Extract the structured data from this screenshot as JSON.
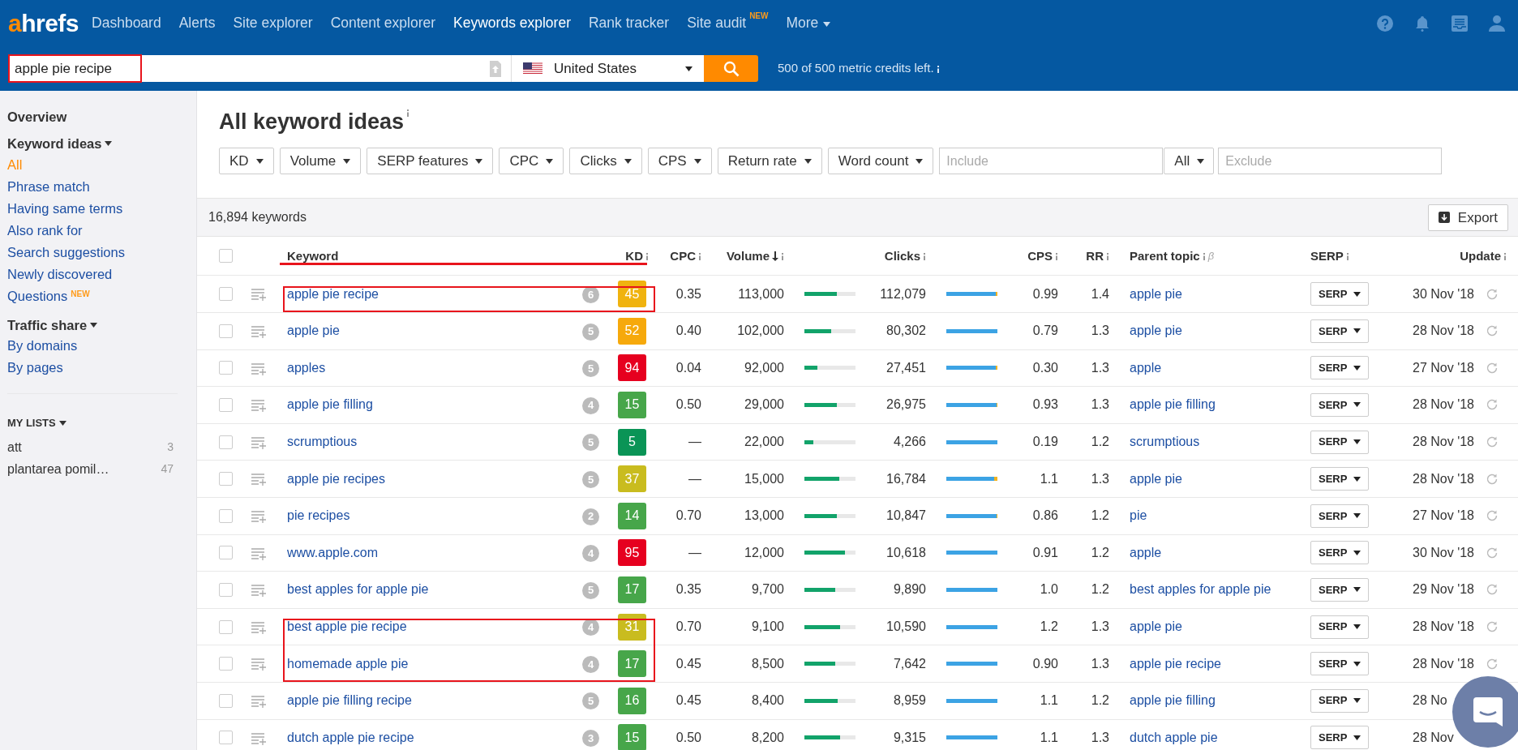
{
  "logo": "ahrefs",
  "nav": [
    {
      "label": "Dashboard",
      "selected": false
    },
    {
      "label": "Alerts",
      "selected": false
    },
    {
      "label": "Site explorer",
      "selected": false
    },
    {
      "label": "Content explorer",
      "selected": false
    },
    {
      "label": "Keywords explorer",
      "selected": true
    },
    {
      "label": "Rank tracker",
      "selected": false
    },
    {
      "label": "Site audit",
      "selected": false,
      "badge": "NEW"
    },
    {
      "label": "More",
      "selected": false,
      "dropdown": true
    }
  ],
  "search": {
    "value": "apple pie recipe",
    "highlighted": true,
    "country": "United States",
    "credits": "500 of 500 metric credits left."
  },
  "sidebar": {
    "overview": "Overview",
    "sections": [
      {
        "title": "Keyword ideas",
        "items": [
          {
            "label": "All",
            "selected": true
          },
          {
            "label": "Phrase match",
            "selected": false
          },
          {
            "label": "Having same terms",
            "selected": false
          },
          {
            "label": "Also rank for",
            "selected": false
          },
          {
            "label": "Search suggestions",
            "selected": false
          },
          {
            "label": "Newly discovered",
            "selected": false
          },
          {
            "label": "Questions",
            "selected": false,
            "badge": "NEW"
          }
        ]
      },
      {
        "title": "Traffic share",
        "items": [
          {
            "label": "By domains",
            "selected": false
          },
          {
            "label": "By pages",
            "selected": false
          }
        ]
      }
    ],
    "lists_title": "MY LISTS",
    "lists": [
      {
        "name": "att",
        "count": "3"
      },
      {
        "name": "plantarea pomil…",
        "count": "47"
      }
    ]
  },
  "page_title": "All keyword ideas",
  "filters": [
    "KD",
    "Volume",
    "SERP features",
    "CPC",
    "Clicks",
    "CPS",
    "Return rate",
    "Word count"
  ],
  "include": {
    "placeholder": "Include",
    "mode": "All"
  },
  "exclude": {
    "placeholder": "Exclude"
  },
  "count": "16,894 keywords",
  "export": "Export",
  "table": {
    "header_checked": false,
    "keyword_header_underlined": true,
    "columns": [
      {
        "label": "Keyword",
        "info": false
      },
      {
        "label": "KD",
        "info": true
      },
      {
        "label": "CPC",
        "info": true
      },
      {
        "label": "Volume",
        "info": true,
        "sorted": true
      },
      {
        "label": "Clicks",
        "info": true
      },
      {
        "label": "CPS",
        "info": true
      },
      {
        "label": "RR",
        "info": true
      },
      {
        "label": "Parent topic",
        "info": true,
        "badge": "β"
      },
      {
        "label": "SERP",
        "info": true
      },
      {
        "label": "Update",
        "info": true
      }
    ],
    "rows": [
      {
        "checked": false,
        "keyword": "apple pie recipe",
        "count": "6",
        "kd": {
          "value": "45",
          "color": "#f0b30f"
        },
        "cpc": "0.35",
        "volume": "113,000",
        "volume_bar": {
          "level": 0.64
        },
        "clicks": "112,079",
        "clicks_bar": {
          "level": 0.97
        },
        "cps": "0.99",
        "rr": "1.4",
        "parent_topic": "apple pie",
        "serp": "SERP",
        "update": "30 Nov '18",
        "refresh": true,
        "highlighted": true
      },
      {
        "checked": false,
        "keyword": "apple pie",
        "count": "5",
        "kd": {
          "value": "52",
          "color": "#f6a90c"
        },
        "cpc": "0.40",
        "volume": "102,000",
        "volume_bar": {
          "level": 0.53
        },
        "clicks": "80,302",
        "clicks_bar": {
          "level": 1
        },
        "cps": "0.79",
        "rr": "1.3",
        "parent_topic": "apple pie",
        "serp": "SERP",
        "update": "28 Nov '18",
        "refresh": true,
        "highlighted": false
      },
      {
        "checked": false,
        "keyword": "apples",
        "count": "5",
        "kd": {
          "value": "94",
          "color": "#e6001f"
        },
        "cpc": "0.04",
        "volume": "92,000",
        "volume_bar": {
          "level": 0.25
        },
        "clicks": "27,451",
        "clicks_bar": {
          "level": 0.97
        },
        "cps": "0.30",
        "rr": "1.3",
        "parent_topic": "apple",
        "serp": "SERP",
        "update": "27 Nov '18",
        "refresh": true,
        "highlighted": false
      },
      {
        "checked": false,
        "keyword": "apple pie filling",
        "count": "4",
        "kd": {
          "value": "15",
          "color": "#47a64a"
        },
        "cpc": "0.50",
        "volume": "29,000",
        "volume_bar": {
          "level": 0.64
        },
        "clicks": "26,975",
        "clicks_bar": {
          "level": 0.98
        },
        "cps": "0.93",
        "rr": "1.3",
        "parent_topic": "apple pie filling",
        "serp": "SERP",
        "update": "28 Nov '18",
        "refresh": true,
        "highlighted": false
      },
      {
        "checked": false,
        "keyword": "scrumptious",
        "count": "5",
        "kd": {
          "value": "5",
          "color": "#0a9456"
        },
        "cpc": "—",
        "volume": "22,000",
        "volume_bar": {
          "level": 0.17
        },
        "clicks": "4,266",
        "clicks_bar": {
          "level": 1
        },
        "cps": "0.19",
        "rr": "1.2",
        "parent_topic": "scrumptious",
        "serp": "SERP",
        "update": "28 Nov '18",
        "refresh": true,
        "highlighted": false
      },
      {
        "checked": false,
        "keyword": "apple pie recipes",
        "count": "5",
        "kd": {
          "value": "37",
          "color": "#c9bc1f"
        },
        "cpc": "—",
        "volume": "15,000",
        "volume_bar": {
          "level": 0.68
        },
        "clicks": "16,784",
        "clicks_bar": {
          "level": 0.93
        },
        "cps": "1.1",
        "rr": "1.3",
        "parent_topic": "apple pie",
        "serp": "SERP",
        "update": "28 Nov '18",
        "refresh": true,
        "highlighted": false
      },
      {
        "checked": false,
        "keyword": "pie recipes",
        "count": "2",
        "kd": {
          "value": "14",
          "color": "#47a64a"
        },
        "cpc": "0.70",
        "volume": "13,000",
        "volume_bar": {
          "level": 0.64
        },
        "clicks": "10,847",
        "clicks_bar": {
          "level": 0.98
        },
        "cps": "0.86",
        "rr": "1.2",
        "parent_topic": "pie",
        "serp": "SERP",
        "update": "27 Nov '18",
        "refresh": true,
        "highlighted": false
      },
      {
        "checked": false,
        "keyword": "www.apple.com",
        "count": "4",
        "kd": {
          "value": "95",
          "color": "#e6001f"
        },
        "cpc": "—",
        "volume": "12,000",
        "volume_bar": {
          "level": 0.8
        },
        "clicks": "10,618",
        "clicks_bar": {
          "level": 1
        },
        "cps": "0.91",
        "rr": "1.2",
        "parent_topic": "apple",
        "serp": "SERP",
        "update": "30 Nov '18",
        "refresh": true,
        "highlighted": false
      },
      {
        "checked": false,
        "keyword": "best apples for apple pie",
        "count": "5",
        "kd": {
          "value": "17",
          "color": "#47a64a"
        },
        "cpc": "0.35",
        "volume": "9,700",
        "volume_bar": {
          "level": 0.6
        },
        "clicks": "9,890",
        "clicks_bar": {
          "level": 1
        },
        "cps": "1.0",
        "rr": "1.2",
        "parent_topic": "best apples for apple pie",
        "serp": "SERP",
        "update": "29 Nov '18",
        "refresh": true,
        "highlighted": false
      },
      {
        "checked": false,
        "keyword": "best apple pie recipe",
        "count": "4",
        "kd": {
          "value": "31",
          "color": "#c9bc1f"
        },
        "cpc": "0.70",
        "volume": "9,100",
        "volume_bar": {
          "level": 0.7
        },
        "clicks": "10,590",
        "clicks_bar": {
          "level": 1
        },
        "cps": "1.2",
        "rr": "1.3",
        "parent_topic": "apple pie",
        "serp": "SERP",
        "update": "28 Nov '18",
        "refresh": true,
        "highlighted": true
      },
      {
        "checked": false,
        "keyword": "homemade apple pie",
        "count": "4",
        "kd": {
          "value": "17",
          "color": "#47a64a"
        },
        "cpc": "0.45",
        "volume": "8,500",
        "volume_bar": {
          "level": 0.6
        },
        "clicks": "7,642",
        "clicks_bar": {
          "level": 1
        },
        "cps": "0.90",
        "rr": "1.3",
        "parent_topic": "apple pie recipe",
        "serp": "SERP",
        "update": "28 Nov '18",
        "refresh": true,
        "highlighted": true
      },
      {
        "checked": false,
        "keyword": "apple pie filling recipe",
        "count": "5",
        "kd": {
          "value": "16",
          "color": "#47a64a"
        },
        "cpc": "0.45",
        "volume": "8,400",
        "volume_bar": {
          "level": 0.65
        },
        "clicks": "8,959",
        "clicks_bar": {
          "level": 1
        },
        "cps": "1.1",
        "rr": "1.2",
        "parent_topic": "apple pie filling",
        "serp": "SERP",
        "update": "28 No",
        "refresh": false,
        "highlighted": false
      },
      {
        "checked": false,
        "keyword": "dutch apple pie recipe",
        "count": "3",
        "kd": {
          "value": "15",
          "color": "#47a64a"
        },
        "cpc": "0.50",
        "volume": "8,200",
        "volume_bar": {
          "level": 0.7
        },
        "clicks": "9,315",
        "clicks_bar": {
          "level": 1
        },
        "cps": "1.1",
        "rr": "1.3",
        "parent_topic": "dutch apple pie",
        "serp": "SERP",
        "update": "28 Nov",
        "refresh": false,
        "highlighted": false
      }
    ]
  },
  "chat": true
}
